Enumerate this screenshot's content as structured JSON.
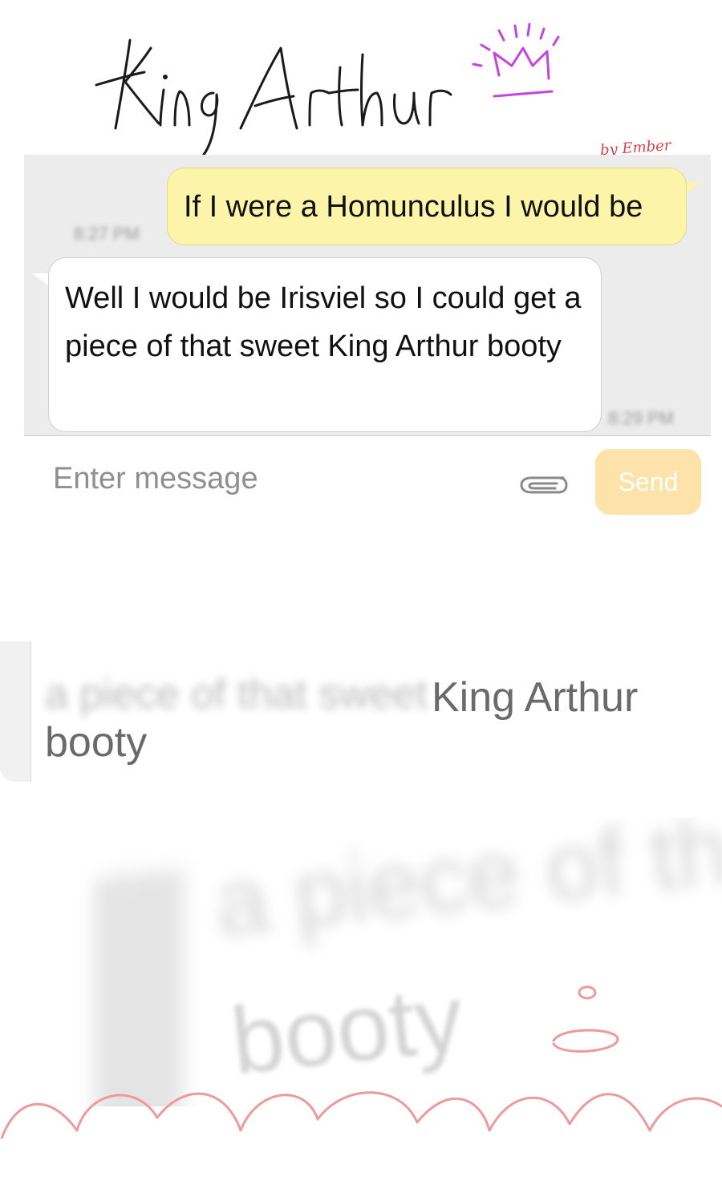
{
  "title": "King Arthur",
  "signature": "by Ember",
  "chat": {
    "outgoing": {
      "text": "If I were a Homunculus I would be",
      "time": "8:27 PM"
    },
    "incoming": {
      "text": "Well I would be Irisviel so I could get a piece of that sweet King Arthur booty",
      "time": "8:29 PM"
    }
  },
  "input": {
    "placeholder": "Enter message",
    "send_label": "Send",
    "attach_icon": "paperclip-icon"
  },
  "echo_1": {
    "line_blurred": "a piece of that sweet",
    "line_sharp": "King Arthur",
    "line_2": "booty"
  },
  "echo_2": {
    "line_1": "a piece of that",
    "line_2": "booty"
  },
  "colors": {
    "title_ink": "#1a1a1a",
    "crown": "#c544e0",
    "signature": "#d9414f",
    "outgoing_bubble": "#fcf4a8",
    "incoming_bubble": "#ffffff",
    "chat_background": "#ececec",
    "send_button": "#fde3a9",
    "doodle": "#ee9a9a"
  }
}
